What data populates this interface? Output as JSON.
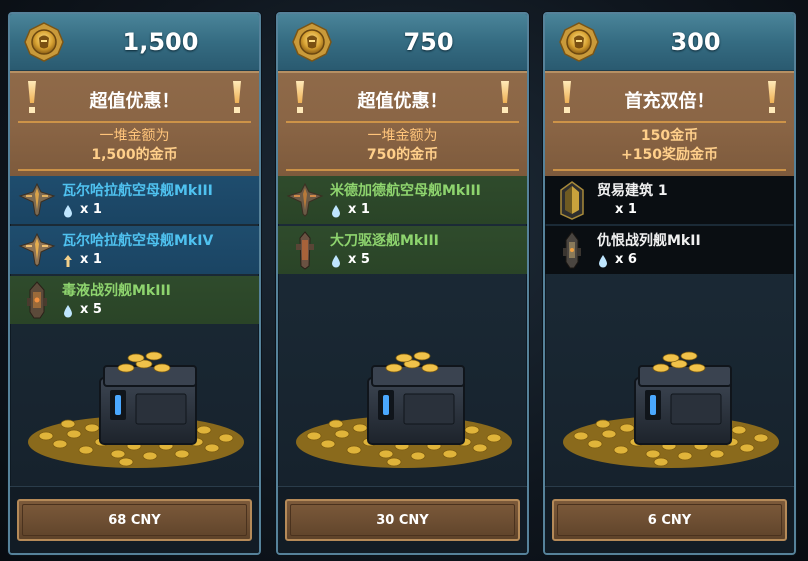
{
  "colors": {
    "card_header": "#3b7890",
    "offer_bg": "#8a6545",
    "offer_accent": "#d89b49",
    "item_blue": "#1f4d6e",
    "item_green": "#2f4b2c",
    "item_black": "#0a0e12",
    "name_blue": "#4fc2f0",
    "name_green": "#8ed46e"
  },
  "cards": [
    {
      "amount": "1,500",
      "offer_title": "超值优惠！",
      "desc_line1": "一堆金额为",
      "desc_line2": "1,500的金币",
      "items": [
        {
          "name": "瓦尔哈拉航空母舰MkIII",
          "qty": "x 1",
          "qty_icon": "water-drop-icon",
          "ship_icon": "carrier-ship-icon",
          "tier": "blue"
        },
        {
          "name": "瓦尔哈拉航空母舰MkIV",
          "qty": "x 1",
          "qty_icon": "upgrade-arrow-icon",
          "ship_icon": "carrier-ship-icon",
          "tier": "blue"
        },
        {
          "name": "毒液战列舰MkIII",
          "qty": "x 5",
          "qty_icon": "water-drop-icon",
          "ship_icon": "battleship-icon",
          "tier": "green"
        }
      ],
      "price": "68 CNY"
    },
    {
      "amount": "750",
      "offer_title": "超值优惠！",
      "desc_line1": "一堆金额为",
      "desc_line2": "750的金币",
      "items": [
        {
          "name": "米德加德航空母舰MkIII",
          "qty": "x 1",
          "qty_icon": "water-drop-icon",
          "ship_icon": "carrier-ship-icon",
          "tier": "green"
        },
        {
          "name": "大刀驱逐舰MkIII",
          "qty": "x 5",
          "qty_icon": "water-drop-icon",
          "ship_icon": "destroyer-icon",
          "tier": "green"
        }
      ],
      "price": "30 CNY"
    },
    {
      "amount": "300",
      "offer_title": "首充双倍！",
      "desc_line1": "150金币",
      "desc_line2": "+150奖励金币",
      "items": [
        {
          "name": "贸易建筑 1",
          "qty": "x 1",
          "qty_icon": "none",
          "ship_icon": "trade-building-icon",
          "tier": "black"
        },
        {
          "name": "仇恨战列舰MkII",
          "qty": "x 6",
          "qty_icon": "water-drop-icon",
          "ship_icon": "battleship-icon",
          "tier": "black"
        }
      ],
      "price": "6 CNY"
    }
  ]
}
